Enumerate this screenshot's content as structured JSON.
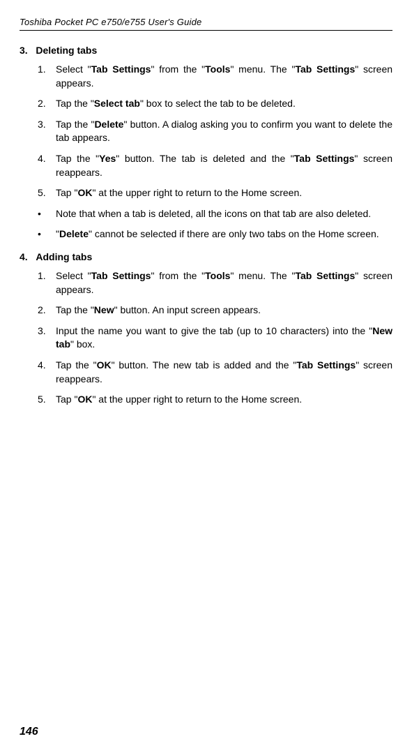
{
  "header": {
    "title": "Toshiba Pocket PC e750/e755  User's Guide"
  },
  "sections": [
    {
      "heading_num": "3.",
      "heading_text": "Deleting tabs",
      "items": [
        {
          "type": "num",
          "n": "1.",
          "parts": [
            {
              "t": "Select \""
            },
            {
              "t": "Tab Settings",
              "b": true
            },
            {
              "t": "\" from the \""
            },
            {
              "t": "Tools",
              "b": true
            },
            {
              "t": "\" menu. The \""
            },
            {
              "t": "Tab Settings",
              "b": true
            },
            {
              "t": "\" screen appears."
            }
          ]
        },
        {
          "type": "num",
          "n": "2.",
          "parts": [
            {
              "t": "Tap the \""
            },
            {
              "t": "Select tab",
              "b": true
            },
            {
              "t": "\" box to select the tab to be deleted."
            }
          ]
        },
        {
          "type": "num",
          "n": "3.",
          "parts": [
            {
              "t": "Tap the \""
            },
            {
              "t": "Delete",
              "b": true
            },
            {
              "t": "\" button. A dialog asking you to confirm you want to delete the tab appears."
            }
          ]
        },
        {
          "type": "num",
          "n": "4.",
          "parts": [
            {
              "t": "Tap the \""
            },
            {
              "t": "Yes",
              "b": true
            },
            {
              "t": "\" button. The tab is deleted and the \""
            },
            {
              "t": "Tab Settings",
              "b": true
            },
            {
              "t": "\" screen reappears."
            }
          ]
        },
        {
          "type": "num",
          "n": "5.",
          "parts": [
            {
              "t": "Tap \""
            },
            {
              "t": "OK",
              "b": true
            },
            {
              "t": "\" at the upper right to return to the Home screen."
            }
          ]
        },
        {
          "type": "bul",
          "n": "•",
          "parts": [
            {
              "t": "Note that when a tab is deleted, all the icons on that tab are also deleted."
            }
          ]
        },
        {
          "type": "bul",
          "n": "•",
          "parts": [
            {
              "t": "\""
            },
            {
              "t": "Delete",
              "b": true
            },
            {
              "t": "\" cannot be selected if there are only two tabs on the Home screen."
            }
          ]
        }
      ]
    },
    {
      "heading_num": "4.",
      "heading_text": "Adding tabs",
      "items": [
        {
          "type": "num",
          "n": "1.",
          "parts": [
            {
              "t": "Select \""
            },
            {
              "t": "Tab Settings",
              "b": true
            },
            {
              "t": "\" from the \""
            },
            {
              "t": "Tools",
              "b": true
            },
            {
              "t": "\" menu. The \""
            },
            {
              "t": "Tab Settings",
              "b": true
            },
            {
              "t": "\" screen appears."
            }
          ]
        },
        {
          "type": "num",
          "n": "2.",
          "parts": [
            {
              "t": "Tap the \""
            },
            {
              "t": "New",
              "b": true
            },
            {
              "t": "\" button. An input screen appears."
            }
          ]
        },
        {
          "type": "num",
          "n": "3.",
          "parts": [
            {
              "t": "Input the name you want to give the tab (up to 10 characters) into the \""
            },
            {
              "t": "New tab",
              "b": true
            },
            {
              "t": "\" box."
            }
          ]
        },
        {
          "type": "num",
          "n": "4.",
          "parts": [
            {
              "t": "Tap the \""
            },
            {
              "t": "OK",
              "b": true
            },
            {
              "t": "\" button. The new tab is added and the \""
            },
            {
              "t": "Tab Settings",
              "b": true
            },
            {
              "t": "\" screen reappears."
            }
          ]
        },
        {
          "type": "num",
          "n": "5.",
          "parts": [
            {
              "t": "Tap \""
            },
            {
              "t": "OK",
              "b": true
            },
            {
              "t": "\" at the upper right to return to the Home screen."
            }
          ]
        }
      ]
    }
  ],
  "page_number": "146"
}
